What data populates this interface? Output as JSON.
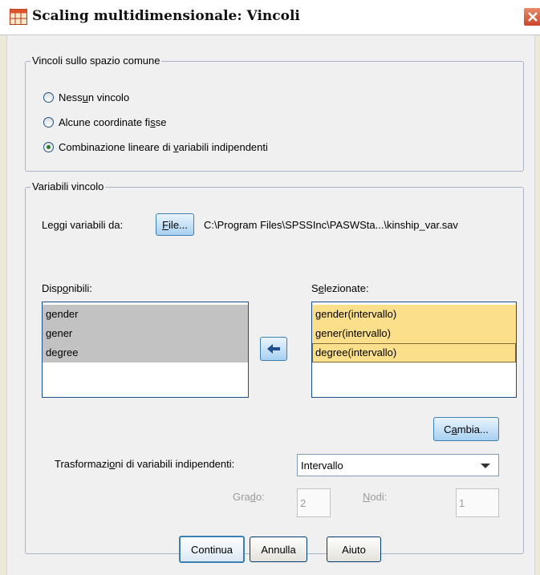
{
  "window": {
    "title": "Scaling multidimensionale: Vincoli",
    "icon": "spss-dialog-icon",
    "close_icon": "close-icon"
  },
  "constraints_group": {
    "legend": "Vincoli sullo spazio comune",
    "options": [
      {
        "pre": "Ness",
        "mn": "u",
        "post": "n vincolo",
        "checked": false
      },
      {
        "pre": "Alcune coordinate fi",
        "mn": "s",
        "post": "se",
        "checked": false
      },
      {
        "pre": "Combinazione lineare di ",
        "mn": "v",
        "post": "ariabili indipendenti",
        "checked": true
      }
    ]
  },
  "variables_group": {
    "legend": "Variabili vincolo",
    "read_from_label": "Leggi variabili da:",
    "file_button": {
      "mn": "F",
      "rest": "ile..."
    },
    "file_path": "C:\\Program Files\\SPSSInc\\PASWSta...\\kinship_var.sav",
    "available": {
      "label_pre": "Disp",
      "label_mn": "o",
      "label_post": "nibili:",
      "items": [
        "gender",
        "gener",
        "degree"
      ]
    },
    "selected": {
      "label_pre": "S",
      "label_mn": "e",
      "label_post": "lezionate:",
      "items": [
        "gender(intervallo)",
        "gener(intervallo)",
        "degree(intervallo)"
      ]
    },
    "move_button_icon": "arrow-left-icon",
    "change_button": {
      "pre": "C",
      "mn": "a",
      "post": "mbia..."
    },
    "transform": {
      "label_pre": "Trasformazi",
      "label_mn": "o",
      "label_post": "ni di variabili indipendenti:",
      "selected": "Intervallo"
    },
    "degree": {
      "label_pre": "Gra",
      "label_mn": "d",
      "label_post": "o:",
      "value": "2"
    },
    "knots": {
      "label_pre": "",
      "label_mn": "N",
      "label_post": "odi:",
      "value": "1"
    }
  },
  "footer": {
    "continue_label": "Continua",
    "cancel_label": "Annulla",
    "help_label": "Aiuto"
  },
  "colors": {
    "selected_highlight": "#fcdf8b",
    "available_highlight": "#c2c2c2",
    "accent_blue": "#a7d0f1"
  }
}
